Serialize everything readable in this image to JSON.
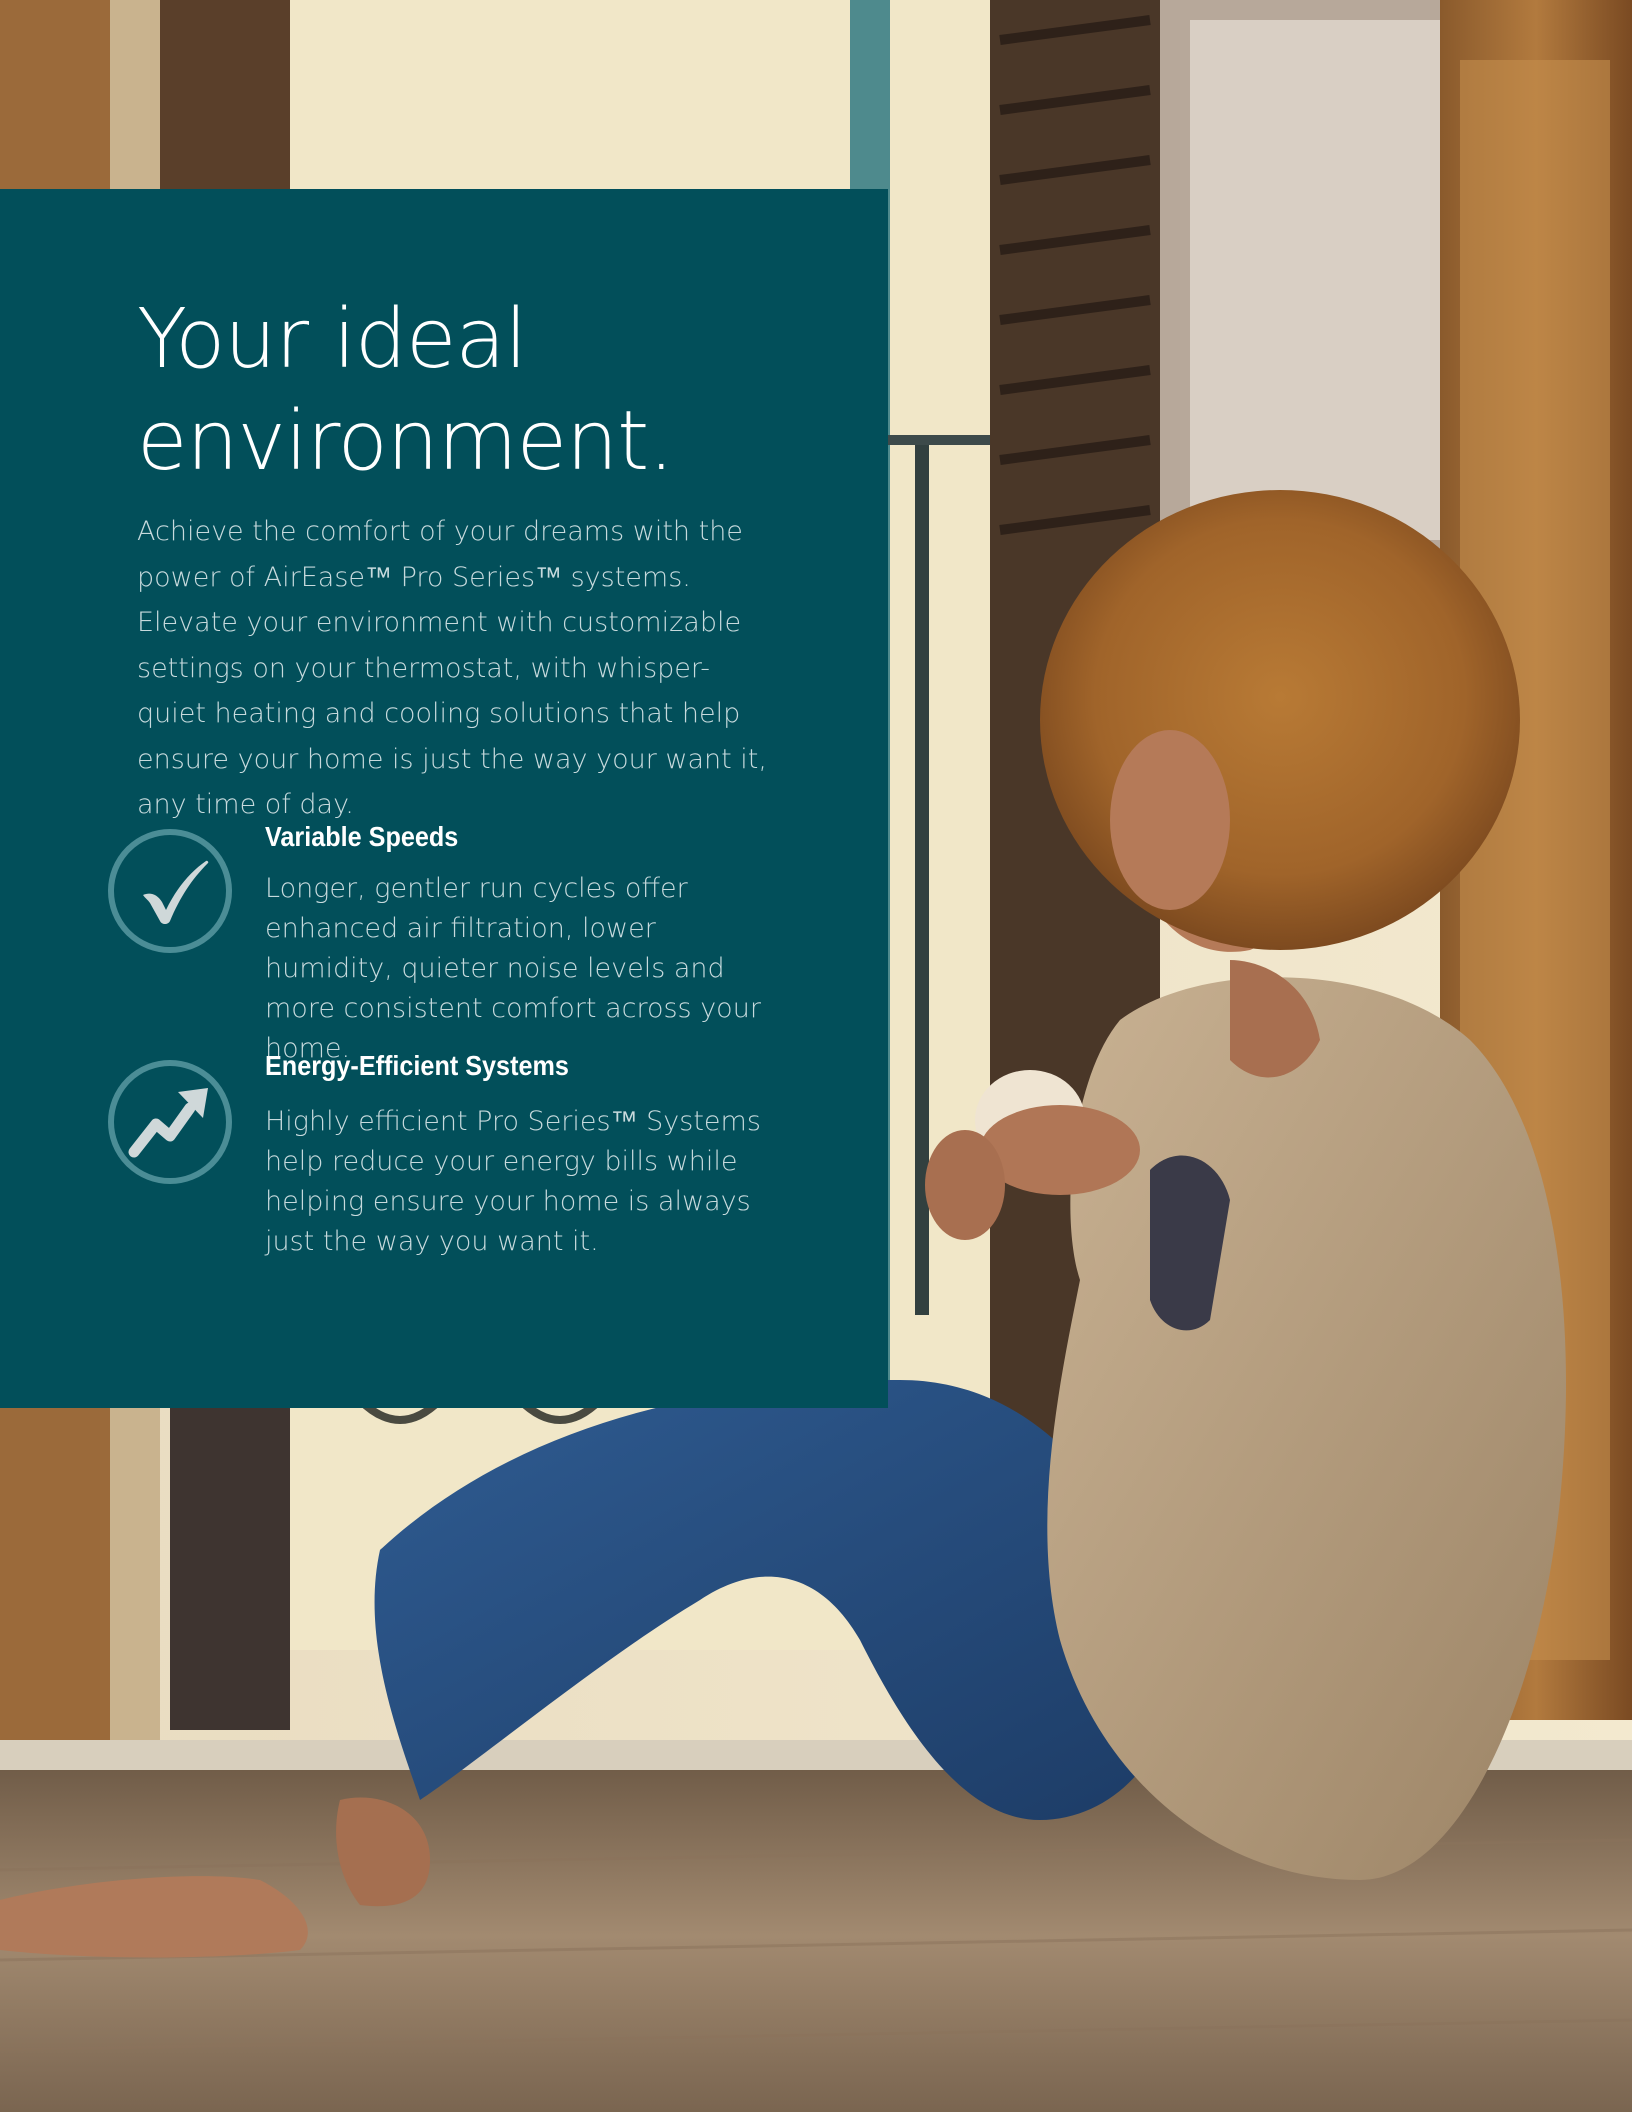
{
  "panel": {
    "headline": "Your ideal\nenvironment.",
    "intro": "Achieve the comfort of your dreams with the power of AirEase™ Pro Series™ systems. Elevate your environment with customizable settings on your thermostat, with whisper-quiet heating and cooling solutions that help ensure your home is just the way your want it, any time of day."
  },
  "features": [
    {
      "icon": "checkmark-icon",
      "title": "Variable Speeds",
      "body": "Longer, gentler run cycles offer enhanced air filtration, lower humidity, quieter noise levels and more consistent comfort across your home."
    },
    {
      "icon": "trend-up-arrow-icon",
      "title": "Energy-Efficient Systems",
      "body": "Highly efficient Pro Series™ Systems help reduce your energy bills while helping ensure your home is always just the way you want it."
    }
  ],
  "colors": {
    "panel": "#024f5a",
    "icon_ring": "#4b8d96",
    "icon_glyph": "#cfd8d9",
    "body_text": "#c7dadd"
  }
}
